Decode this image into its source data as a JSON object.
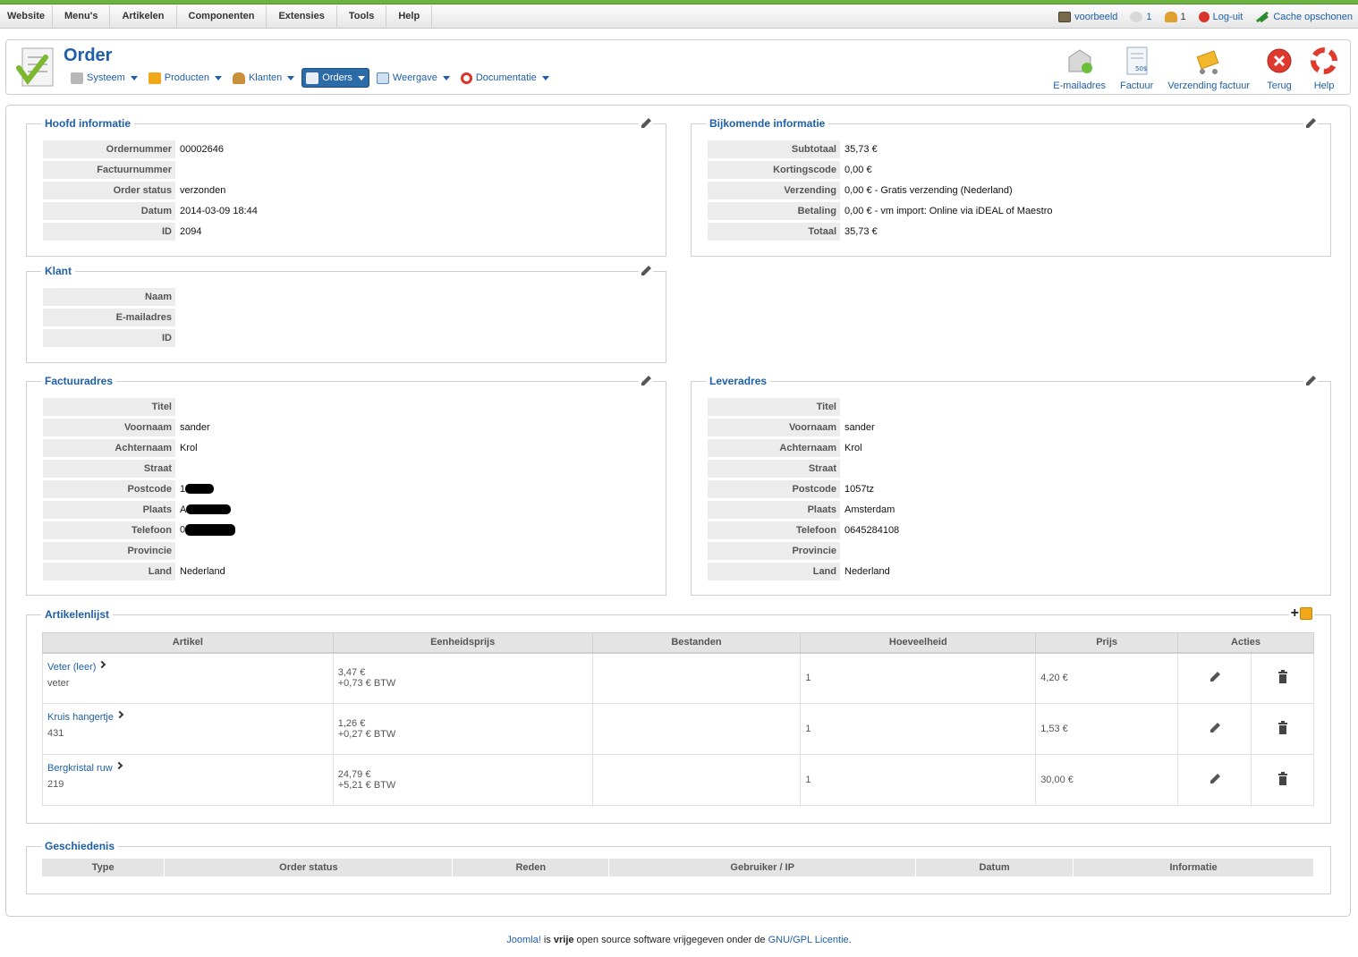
{
  "menubar": {
    "items": [
      "Website",
      "Menu's",
      "Artikelen",
      "Componenten",
      "Extensies",
      "Tools",
      "Help"
    ],
    "status": {
      "site": "voorbeeld",
      "messages": "1",
      "users": "1",
      "logout": "Log-uit",
      "cache": "Cache opschonen"
    }
  },
  "header": {
    "title": "Order",
    "submenu": [
      "Systeem",
      "Producten",
      "Klanten",
      "Orders",
      "Weergave",
      "Documentatie"
    ],
    "toolbar": [
      "E-mailadres",
      "Factuur",
      "Verzending factuur",
      "Terug",
      "Help"
    ]
  },
  "hoofd": {
    "title": "Hoofd informatie",
    "rows": [
      {
        "k": "Ordernummer",
        "v": "00002646"
      },
      {
        "k": "Factuurnummer",
        "v": ""
      },
      {
        "k": "Order status",
        "v": "verzonden"
      },
      {
        "k": "Datum",
        "v": "2014-03-09 18:44"
      },
      {
        "k": "ID",
        "v": "2094"
      }
    ]
  },
  "bijkomend": {
    "title": "Bijkomende informatie",
    "rows": [
      {
        "k": "Subtotaal",
        "v": "35,73 €"
      },
      {
        "k": "Kortingscode",
        "v": "0,00 €"
      },
      {
        "k": "Verzending",
        "v": "0,00 € - Gratis verzending (Nederland)"
      },
      {
        "k": "Betaling",
        "v": "0,00 € - vm import: Online via iDEAL of Maestro"
      },
      {
        "k": "Totaal",
        "v": "35,73 €"
      }
    ]
  },
  "klant": {
    "title": "Klant",
    "rows": [
      {
        "k": "Naam",
        "v": ""
      },
      {
        "k": "E-mailadres",
        "v": ""
      },
      {
        "k": "ID",
        "v": ""
      }
    ]
  },
  "factuur": {
    "title": "Factuuradres",
    "rows": [
      {
        "k": "Titel",
        "v": ""
      },
      {
        "k": "Voornaam",
        "v": "sander"
      },
      {
        "k": "Achternaam",
        "v": "Krol"
      },
      {
        "k": "Straat",
        "v": ""
      },
      {
        "k": "Postcode",
        "v": "1"
      },
      {
        "k": "Plaats",
        "v": "A"
      },
      {
        "k": "Telefoon",
        "v": "0"
      },
      {
        "k": "Provincie",
        "v": ""
      },
      {
        "k": "Land",
        "v": "Nederland"
      }
    ]
  },
  "lever": {
    "title": "Leveradres",
    "rows": [
      {
        "k": "Titel",
        "v": ""
      },
      {
        "k": "Voornaam",
        "v": "sander"
      },
      {
        "k": "Achternaam",
        "v": "Krol"
      },
      {
        "k": "Straat",
        "v": ""
      },
      {
        "k": "Postcode",
        "v": "1057tz"
      },
      {
        "k": "Plaats",
        "v": "Amsterdam"
      },
      {
        "k": "Telefoon",
        "v": "0645284108"
      },
      {
        "k": "Provincie",
        "v": ""
      },
      {
        "k": "Land",
        "v": "Nederland"
      }
    ]
  },
  "artikelen": {
    "title": "Artikelenlijst",
    "headers": [
      "Artikel",
      "Eenheidsprijs",
      "Bestanden",
      "Hoeveelheid",
      "Prijs",
      "Acties"
    ],
    "rows": [
      {
        "name": "Veter (leer)",
        "sku": "veter",
        "unit": "3,47 €",
        "tax": "+0,73 € BTW",
        "qty": "1",
        "price": "4,20 €"
      },
      {
        "name": "Kruis hangertje",
        "sku": "431",
        "unit": "1,26 €",
        "tax": "+0,27 € BTW",
        "qty": "1",
        "price": "1,53 €"
      },
      {
        "name": "Bergkristal ruw",
        "sku": "219",
        "unit": "24,79 €",
        "tax": "+5,21 € BTW",
        "qty": "1",
        "price": "30,00 €"
      }
    ]
  },
  "geschiedenis": {
    "title": "Geschiedenis",
    "headers": [
      "Type",
      "Order status",
      "Reden",
      "Gebruiker / IP",
      "Datum",
      "Informatie"
    ]
  },
  "footer": {
    "joomla": "Joomla!",
    "is": " is ",
    "vrije": "vrije",
    "text": " open source software vrijgegeven onder de ",
    "license": "GNU/GPL Licentie",
    "dot": "."
  },
  "colors": {
    "accent": "#1f5fa8",
    "topstripe": "#6db33f",
    "label_bg": "#ececec"
  }
}
